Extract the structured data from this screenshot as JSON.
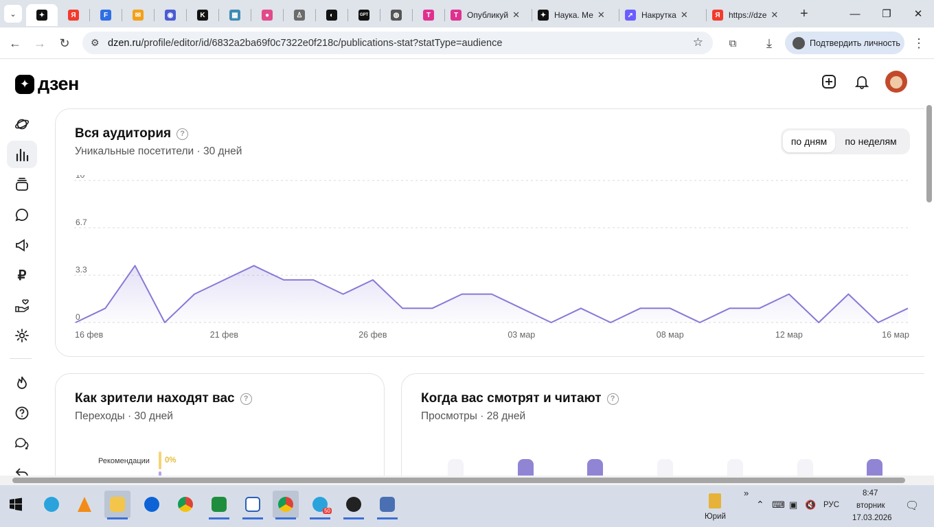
{
  "browser": {
    "tabs": [
      {
        "title": "",
        "color": "#111111",
        "glyph": "✦",
        "active": true
      },
      {
        "title": "",
        "color": "#f33a2d",
        "glyph": "Я"
      },
      {
        "title": "",
        "color": "#2f6fe4",
        "glyph": "F"
      },
      {
        "title": "",
        "color": "#f3a019",
        "glyph": "✉"
      },
      {
        "title": "",
        "color": "#4a5bd4",
        "glyph": "◉"
      },
      {
        "title": "",
        "color": "#111111",
        "glyph": "K"
      },
      {
        "title": "",
        "color": "#3d8bb5",
        "glyph": "▦"
      },
      {
        "title": "",
        "color": "#e14b8a",
        "glyph": "●"
      },
      {
        "title": "",
        "color": "#6b6b6b",
        "glyph": "♙"
      },
      {
        "title": "",
        "color": "#111111",
        "glyph": "◐"
      },
      {
        "title": "",
        "color": "#111111",
        "glyph": "GPT"
      },
      {
        "title": "",
        "color": "#555555",
        "glyph": "◍"
      },
      {
        "title": "",
        "color": "#e0308f",
        "glyph": "T"
      },
      {
        "title": "Опубликуй",
        "color": "#e0308f",
        "glyph": "T"
      },
      {
        "title": "Наука. Ме",
        "color": "#111111",
        "glyph": "✦"
      },
      {
        "title": "Накрутка",
        "color": "#6a5cff",
        "glyph": "➚"
      },
      {
        "title": "https://dze",
        "color": "#f33a2d",
        "glyph": "Я"
      }
    ],
    "url_host": "dzen.ru",
    "url_path": "/profile/editor/id/6832a2ba69f0c7322e0f218c/publications-stat?statType=audience",
    "verify_label": "Подтвердить личность"
  },
  "header": {
    "logo_text": "дзен"
  },
  "audience": {
    "title": "Вся аудитория",
    "subtitle_a": "Уникальные посетители",
    "subtitle_b": "30 дней",
    "toggle_days": "по дням",
    "toggle_weeks": "по неделям"
  },
  "chart_data": {
    "type": "area",
    "y_ticks": [
      "10",
      "6.7",
      "3.3",
      "0"
    ],
    "ylim": [
      0,
      10
    ],
    "x_tick_labels": [
      "16 фев",
      "21 фев",
      "26 фев",
      "03 мар",
      "08 мар",
      "12 мар",
      "16 мар"
    ],
    "series": [
      {
        "values": [
          0,
          1,
          4,
          0,
          2,
          3,
          4,
          3,
          3,
          2,
          3,
          1,
          1,
          2,
          2,
          1,
          0,
          1,
          0,
          1,
          1,
          0,
          1,
          1,
          2,
          0,
          2,
          0,
          1
        ]
      }
    ],
    "line_color": "#8679d6",
    "grid": true
  },
  "sources": {
    "title": "Как зрители находят вас",
    "subtitle_a": "Переходы",
    "subtitle_b": "30 дней",
    "rows": [
      {
        "label": "Рекомендации",
        "pct": "0%",
        "color": "#f4d478"
      }
    ]
  },
  "schedule": {
    "title": "Когда вас смотрят и читают",
    "subtitle_a": "Просмотры",
    "subtitle_b": "28 дней",
    "bubbles": [
      0,
      1,
      1,
      0,
      0,
      0,
      1
    ]
  },
  "taskbar": {
    "user": "Юрий",
    "lang": "РУС",
    "time": "8:47",
    "weekday": "вторник",
    "date": "17.03.2026"
  }
}
